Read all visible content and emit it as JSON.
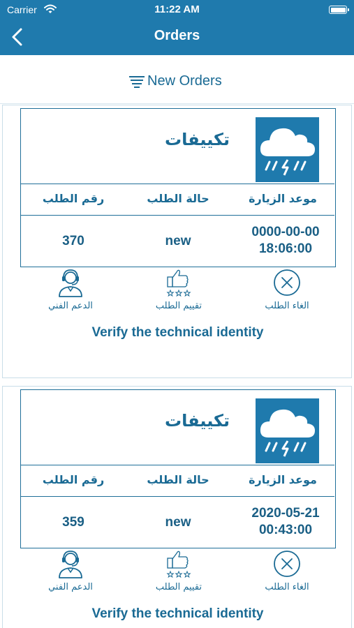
{
  "status_bar": {
    "carrier": "Carrier",
    "time": "11:22 AM"
  },
  "nav": {
    "title": "Orders"
  },
  "filter": {
    "label": "New Orders"
  },
  "orders": [
    {
      "category": "تكييفات",
      "headers": {
        "date": "موعد الزيارة",
        "status": "حالة الطلب",
        "number": "رقم الطلب"
      },
      "date_line1": "0000-00-00",
      "date_line2": "18:06:00",
      "status": "new",
      "number": "370",
      "actions": {
        "cancel": "الغاء الطلب",
        "rate": "تقييم الطلب",
        "support": "الدعم الفني"
      },
      "verify": "Verify the technical identity"
    },
    {
      "category": "تكييفات",
      "headers": {
        "date": "موعد الزيارة",
        "status": "حالة الطلب",
        "number": "رقم الطلب"
      },
      "date_line1": "2020-05-21",
      "date_line2": "00:43:00",
      "status": "new",
      "number": "359",
      "actions": {
        "cancel": "الغاء الطلب",
        "rate": "تقييم الطلب",
        "support": "الدعم الفني"
      },
      "verify": "Verify the technical identity"
    }
  ],
  "colors": {
    "primary": "#1f7aad",
    "text": "#1a6a94",
    "border": "#1f6f99"
  },
  "icons": [
    "wifi-icon",
    "battery-icon",
    "back-chevron-icon",
    "list-filter-icon",
    "rain-cloud-icon",
    "cancel-x-icon",
    "thumbs-up-stars-icon",
    "support-agent-icon"
  ]
}
